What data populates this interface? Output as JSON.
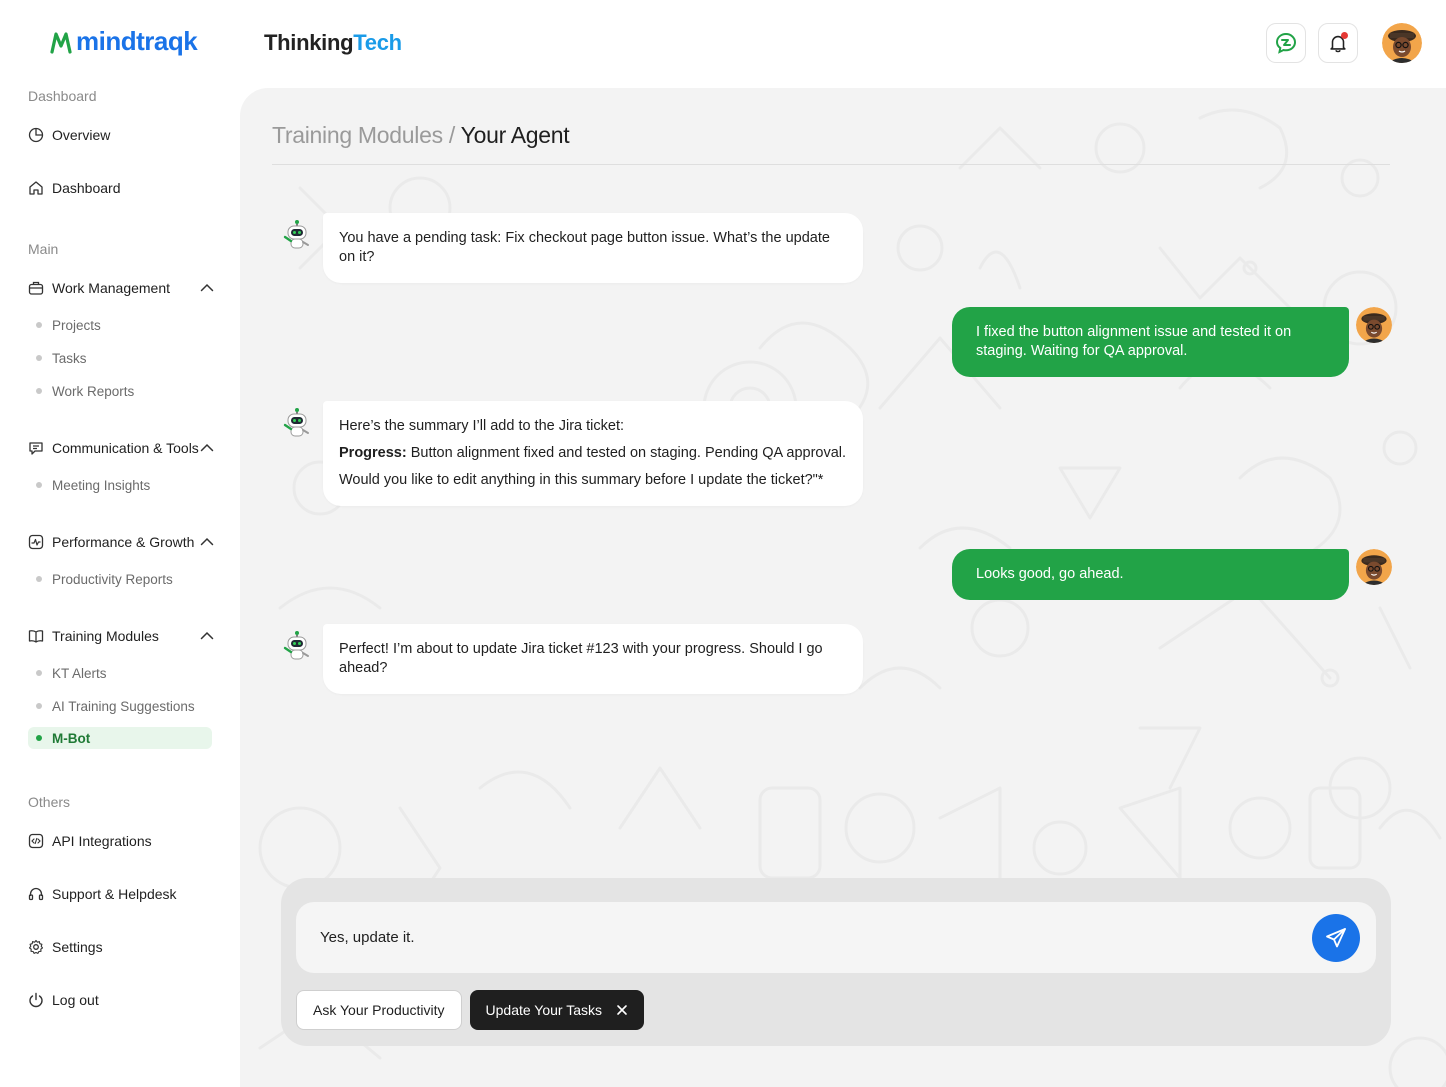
{
  "brand": {
    "logo_text": "mindtraqk",
    "company_prefix": "Thinking",
    "company_suffix": "Tech"
  },
  "sidebar": {
    "sections": {
      "dashboard": "Dashboard",
      "main": "Main",
      "others": "Others"
    },
    "items": {
      "overview": "Overview",
      "dashboard": "Dashboard",
      "work_management": "Work Management",
      "projects": "Projects",
      "tasks": "Tasks",
      "work_reports": "Work Reports",
      "communication_tools": "Communication & Tools",
      "meeting_insights": "Meeting Insights",
      "performance_growth": "Performance & Growth",
      "productivity_reports": "Productivity Reports",
      "training_modules": "Training Modules",
      "kt_alerts": "KT Alerts",
      "ai_training_suggestions": "AI Training Suggestions",
      "m_bot": "M-Bot",
      "api_integrations": "API Integrations",
      "support_helpdesk": "Support & Helpdesk",
      "settings": "Settings",
      "log_out": "Log out"
    }
  },
  "breadcrumb": {
    "parent": "Training Modules",
    "separator": "/",
    "current": "Your Agent"
  },
  "chat": {
    "messages": [
      {
        "from": "bot",
        "text": "You have a pending task: Fix checkout page button issue. What’s the update on it?"
      },
      {
        "from": "user",
        "text": "I fixed the button alignment issue and tested it on staging. Waiting for QA approval."
      },
      {
        "from": "bot",
        "intro": "Here’s the summary I’ll add to the Jira ticket:",
        "bold": "Progress:",
        "body": " Button alignment fixed and tested on staging. Pending QA approval.",
        "question": "Would you like to edit anything in this summary before I update the ticket?\"*"
      },
      {
        "from": "user",
        "text": "Looks good, go ahead."
      },
      {
        "from": "bot",
        "text": "Perfect! I’m about to update Jira ticket #123 with your progress. Should I go ahead?"
      }
    ]
  },
  "composer": {
    "value": "Yes, update it.",
    "chips": {
      "ask": "Ask Your Productivity",
      "update": "Update Your Tasks"
    }
  },
  "colors": {
    "accent_green": "#22a347",
    "send_blue": "#1a73e8",
    "notification_red": "#e53935"
  }
}
